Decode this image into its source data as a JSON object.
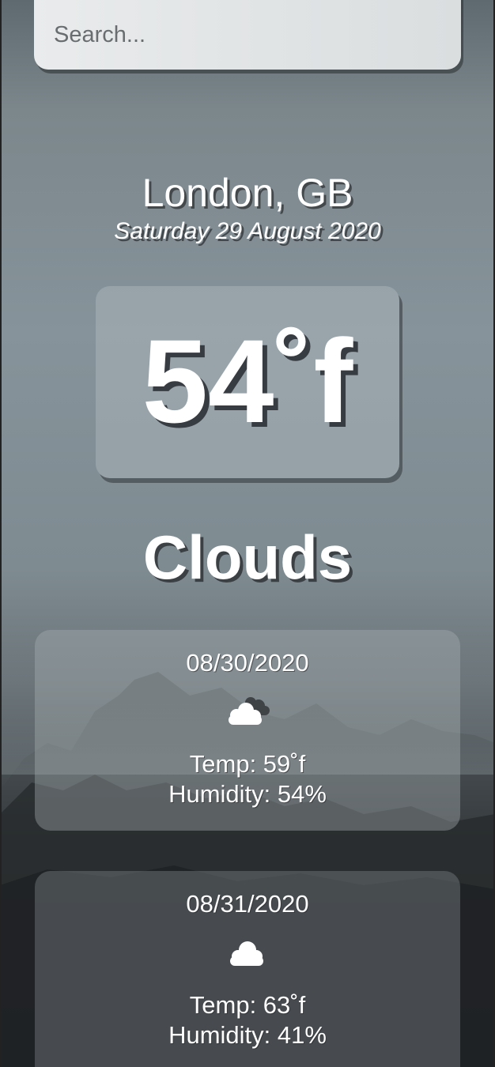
{
  "search": {
    "placeholder": "Search...",
    "value": ""
  },
  "location": {
    "name": "London, GB",
    "date": "Saturday 29 August 2020"
  },
  "current": {
    "temperature": "54˚f",
    "condition": "Clouds"
  },
  "forecast": [
    {
      "date": "08/30/2020",
      "icon": "broken-clouds-icon",
      "temp": "Temp: 59˚f",
      "humidity": "Humidity: 54%"
    },
    {
      "date": "08/31/2020",
      "icon": "cloud-icon",
      "temp": "Temp: 63˚f",
      "humidity": "Humidity: 41%"
    }
  ],
  "colors": {
    "text": "#ffffff",
    "search_bg": "#e4e7e8",
    "shadow": "#3c4044"
  }
}
